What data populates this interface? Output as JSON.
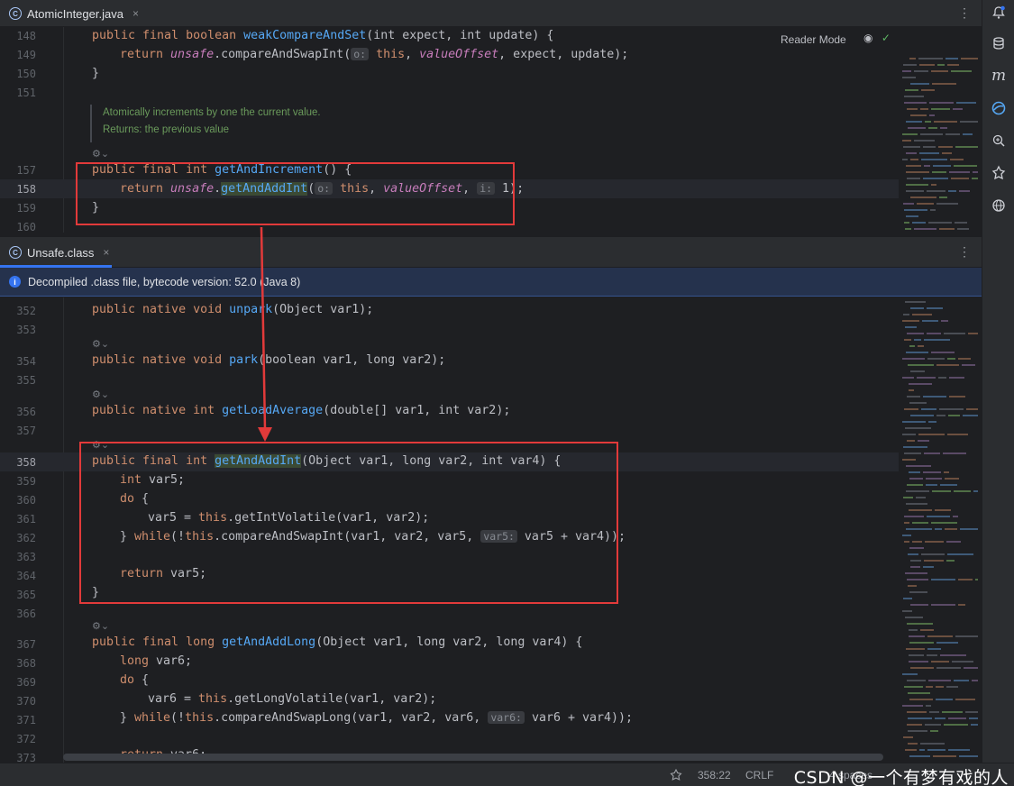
{
  "top_tab": {
    "label": "AtomicInteger.java",
    "close": "×",
    "more": "⋮"
  },
  "reader_mode": {
    "label": "Reader Mode",
    "eye": "◉",
    "check": "✓"
  },
  "top_gutter": [
    "148",
    "149",
    "150",
    "151",
    "157",
    "158",
    "159",
    "160"
  ],
  "top_code": {
    "l148": {
      "kw": "public final boolean ",
      "fn": "weakCompareAndSet",
      "rest": "(int expect, int update) {"
    },
    "l149": {
      "kw": "return ",
      "field": "unsafe",
      "rest": ".compareAndSwapInt(",
      "hint": "o:",
      "this": " this",
      "field2": "valueOffset",
      "rest2": ", expect, update);"
    },
    "l150": "}",
    "l157": {
      "kw": "public final int ",
      "fn": "getAndIncrement",
      "rest": "() {"
    },
    "l158": {
      "kw": "return ",
      "field": "unsafe",
      "dot": ".",
      "fn": "getAndAddInt",
      "paren": "(",
      "hint": "o:",
      "this": " this",
      "field2": "valueOffset",
      "comma": ", ",
      "hint2": "i:",
      "rest2": " 1);"
    },
    "l159": "}"
  },
  "doc": {
    "line1": "Atomically increments by one the current value.",
    "line2": "Returns: the previous value"
  },
  "bottom_tab": {
    "label": "Unsafe.class",
    "close": "×",
    "more": "⋮"
  },
  "infobar": {
    "icon": "i",
    "text": "Decompiled .class file, bytecode version: 52.0 (Java 8)"
  },
  "bottom_gutter": [
    "352",
    "353",
    "354",
    "355",
    "356",
    "357",
    "358",
    "359",
    "360",
    "361",
    "362",
    "363",
    "364",
    "365",
    "366",
    "367",
    "368",
    "369",
    "370",
    "371",
    "372",
    "373"
  ],
  "bottom_code": {
    "l352": {
      "kw": "public native void ",
      "fn": "unpark",
      "rest": "(Object var1);"
    },
    "l354": {
      "kw": "public native void ",
      "fn": "park",
      "rest": "(boolean var1, long var2);"
    },
    "l356": {
      "kw": "public native int ",
      "fn": "getLoadAverage",
      "rest": "(double[] var1, int var2);"
    },
    "l358": {
      "kw": "public final int ",
      "fn": "getAndAddInt",
      "rest": "(Object var1, long var2, int var4) {"
    },
    "l359": {
      "kw": "int ",
      "rest": "var5;"
    },
    "l360": {
      "kw": "do ",
      "rest": "{"
    },
    "l361": {
      "pre": "var5 = ",
      "kw": "this",
      "rest": ".getIntVolatile(var1, var2);"
    },
    "l362": {
      "pre": "} ",
      "kw": "while",
      "mid": "(!",
      "kw2": "this",
      "rest": ".compareAndSwapInt(var1, var2, var5, ",
      "hint": "var5:",
      "rest2": " var5 + var4));"
    },
    "l364": {
      "kw": "return ",
      "rest": "var5;"
    },
    "l365": "}",
    "l367": {
      "kw": "public final long ",
      "fn": "getAndAddLong",
      "rest": "(Object var1, long var2, long var4) {"
    },
    "l368": {
      "kw": "long ",
      "rest": "var6;"
    },
    "l369": {
      "kw": "do ",
      "rest": "{"
    },
    "l370": {
      "pre": "var6 = ",
      "kw": "this",
      "rest": ".getLongVolatile(var1, var2);"
    },
    "l371": {
      "pre": "} ",
      "kw": "while",
      "mid": "(!",
      "kw2": "this",
      "rest": ".compareAndSwapLong(var1, var2, var6, ",
      "hint": "var6:",
      "rest2": " var6 + var4));"
    },
    "l373": {
      "kw": "return ",
      "rest": "var6;"
    }
  },
  "fold_glyph": "⚙⌄",
  "status": {
    "position": "358:22",
    "line_sep": "CRLF",
    "indent": "4 spaces"
  },
  "watermark": "CSDN @一个有梦有戏的人",
  "right_toolbar": [
    "notifications-icon",
    "database-icon",
    "maven-icon",
    "ai-assistant-icon",
    "structure-search-icon",
    "plugin-icon",
    "web-icon"
  ],
  "colors": {
    "keyword": "#cf8e6d",
    "function": "#56a8f5",
    "field": "#c77dbb",
    "doc": "#6a9a5b",
    "accent": "#3574f0",
    "highlight_box": "#e23a3a"
  }
}
